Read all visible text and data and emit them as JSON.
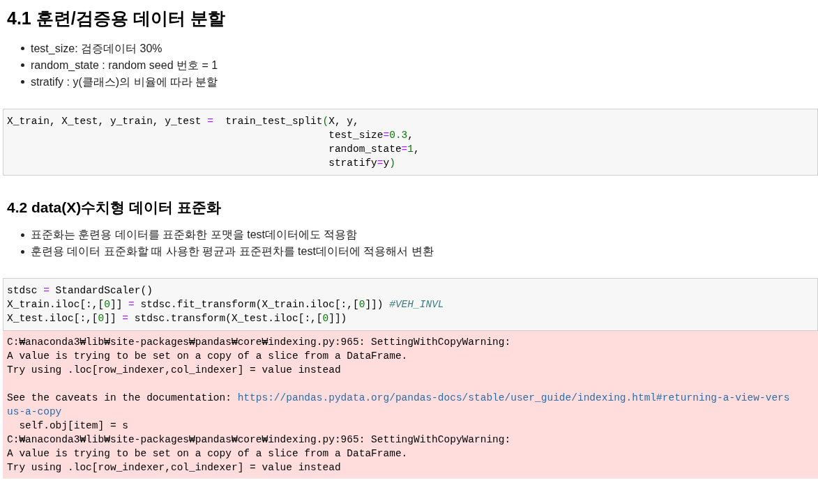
{
  "sections": [
    {
      "heading": "4.1 훈련/검증용 데이터 분할",
      "bullets": [
        "test_size: 검증데이터 30%",
        "random_state : random seed 번호 = 1",
        "stratify : y(클래스)의 비율에 따라 분할"
      ],
      "code": [
        [
          {
            "kind": "plain",
            "text": "X_train, X_test, y_train, y_test "
          },
          {
            "kind": "op",
            "text": "="
          },
          {
            "kind": "plain",
            "text": "  train_test_split"
          },
          {
            "kind": "num",
            "text": "("
          },
          {
            "kind": "plain",
            "text": "X, y,"
          }
        ],
        [
          {
            "kind": "plain",
            "text": "                                                     test_size"
          },
          {
            "kind": "op",
            "text": "="
          },
          {
            "kind": "num",
            "text": "0.3"
          },
          {
            "kind": "plain",
            "text": ","
          }
        ],
        [
          {
            "kind": "plain",
            "text": "                                                     random_state"
          },
          {
            "kind": "op",
            "text": "="
          },
          {
            "kind": "num",
            "text": "1"
          },
          {
            "kind": "plain",
            "text": ","
          }
        ],
        [
          {
            "kind": "plain",
            "text": "                                                     stratify"
          },
          {
            "kind": "op",
            "text": "="
          },
          {
            "kind": "plain",
            "text": "y"
          },
          {
            "kind": "num",
            "text": ")"
          }
        ]
      ]
    },
    {
      "heading": "4.2 data(X)수치형 데이터 표준화",
      "bullets": [
        "표준화는 훈련용 데이터를 표준화한 포맷을 test데이터에도 적용함",
        "훈련용 데이터 표준화할 때 사용한 평균과 표준편차를 test데이터에 적용해서 변환"
      ],
      "code": [
        [
          {
            "kind": "plain",
            "text": "stdsc "
          },
          {
            "kind": "op",
            "text": "="
          },
          {
            "kind": "plain",
            "text": " StandardScaler()"
          }
        ],
        [
          {
            "kind": "plain",
            "text": "X_train.iloc[:,["
          },
          {
            "kind": "num",
            "text": "0"
          },
          {
            "kind": "plain",
            "text": "]] "
          },
          {
            "kind": "op",
            "text": "="
          },
          {
            "kind": "plain",
            "text": " stdsc.fit_transform(X_train.iloc[:,["
          },
          {
            "kind": "num",
            "text": "0"
          },
          {
            "kind": "plain",
            "text": "]]) "
          },
          {
            "kind": "comment",
            "text": "#VEH_INVL"
          }
        ],
        [
          {
            "kind": "plain",
            "text": "X_test.iloc[:,["
          },
          {
            "kind": "num",
            "text": "0"
          },
          {
            "kind": "plain",
            "text": "]] "
          },
          {
            "kind": "op",
            "text": "="
          },
          {
            "kind": "plain",
            "text": " stdsc.transform(X_test.iloc[:,["
          },
          {
            "kind": "num",
            "text": "0"
          },
          {
            "kind": "plain",
            "text": "]])"
          }
        ]
      ],
      "output": [
        [
          {
            "kind": "plain",
            "text": "C:₩anaconda3₩lib₩site-packages₩pandas₩core₩indexing.py:965: SettingWithCopyWarning:"
          }
        ],
        [
          {
            "kind": "plain",
            "text": "A value is trying to be set on a copy of a slice from a DataFrame."
          }
        ],
        [
          {
            "kind": "plain",
            "text": "Try using .loc[row_indexer,col_indexer] = value instead"
          }
        ],
        [
          {
            "kind": "blank"
          }
        ],
        [
          {
            "kind": "plain",
            "text": "See the caveats in the documentation: "
          },
          {
            "kind": "link",
            "text": "https://pandas.pydata.org/pandas-docs/stable/user_guide/indexing.html#returning-a-view-vers"
          }
        ],
        [
          {
            "kind": "link",
            "text": "us-a-copy"
          }
        ],
        [
          {
            "kind": "plain",
            "text": "  self.obj[item] = s"
          }
        ],
        [
          {
            "kind": "plain",
            "text": "C:₩anaconda3₩lib₩site-packages₩pandas₩core₩indexing.py:965: SettingWithCopyWarning:"
          }
        ],
        [
          {
            "kind": "plain",
            "text": "A value is trying to be set on a copy of a slice from a DataFrame."
          }
        ],
        [
          {
            "kind": "plain",
            "text": "Try using .loc[row_indexer,col_indexer] = value instead"
          }
        ]
      ]
    }
  ]
}
